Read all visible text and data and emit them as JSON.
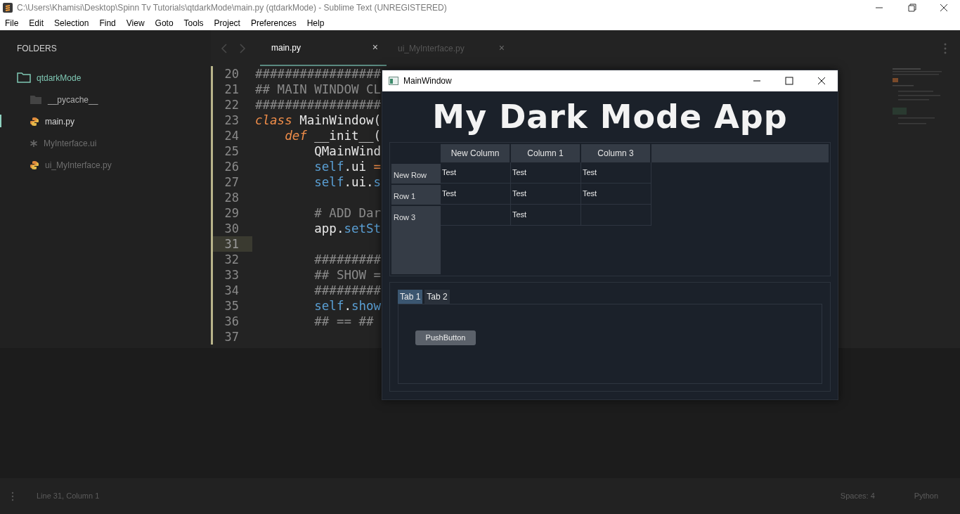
{
  "window": {
    "title": "C:\\Users\\Khamisi\\Desktop\\Spinn Tv Tutorials\\qtdarkMode\\main.py (qtdarkMode) - Sublime Text (UNREGISTERED)"
  },
  "menu": [
    "File",
    "Edit",
    "Selection",
    "Find",
    "View",
    "Goto",
    "Tools",
    "Project",
    "Preferences",
    "Help"
  ],
  "sidebar": {
    "header": "FOLDERS",
    "tree": [
      {
        "label": "qtdarkMode",
        "kind": "folder",
        "selected": false,
        "children": [
          {
            "label": "__pycache__",
            "kind": "folder",
            "selected": false
          },
          {
            "label": "main.py",
            "kind": "python",
            "selected": true
          },
          {
            "label": "MyInterface.ui",
            "kind": "ui",
            "selected": false
          },
          {
            "label": "ui_MyInterface.py",
            "kind": "python",
            "selected": false
          }
        ]
      }
    ]
  },
  "editor_tabs": [
    {
      "label": "main.py",
      "selected": true,
      "close": "×"
    },
    {
      "label": "ui_MyInterface.py",
      "selected": false,
      "close": "×"
    }
  ],
  "code": [
    {
      "number": "20",
      "current": false,
      "tokens": [
        {
          "text": "#################",
          "kind": "comment"
        }
      ]
    },
    {
      "number": "21",
      "current": false,
      "tokens": [
        {
          "text": "## MAIN WINDOW CL",
          "kind": "comment"
        }
      ]
    },
    {
      "number": "22",
      "current": false,
      "tokens": [
        {
          "text": "#################",
          "kind": "comment"
        }
      ]
    },
    {
      "number": "23",
      "current": false,
      "tokens": [
        {
          "text": "class",
          "kind": "keyword"
        },
        {
          "text": " MainWindow(",
          "kind": "plain"
        }
      ]
    },
    {
      "number": "24",
      "current": false,
      "tokens": [
        {
          "text": "    def",
          "kind": "keyword"
        },
        {
          "text": " __init__(",
          "kind": "plain"
        }
      ]
    },
    {
      "number": "25",
      "current": false,
      "tokens": [
        {
          "text": "        QMainWind",
          "kind": "plain"
        }
      ]
    },
    {
      "number": "26",
      "current": false,
      "tokens": [
        {
          "text": "        self",
          "kind": "builtin"
        },
        {
          "text": ".ui ",
          "kind": "plain"
        },
        {
          "text": "=",
          "kind": "operator"
        }
      ]
    },
    {
      "number": "27",
      "current": false,
      "tokens": [
        {
          "text": "        self",
          "kind": "builtin"
        },
        {
          "text": ".ui.",
          "kind": "plain"
        },
        {
          "text": "s",
          "kind": "builtin"
        }
      ]
    },
    {
      "number": "28",
      "current": false
    },
    {
      "number": "29",
      "current": false,
      "tokens": [
        {
          "text": "        # ADD Dar",
          "kind": "comment"
        }
      ]
    },
    {
      "number": "30",
      "current": false,
      "tokens": [
        {
          "text": "        app.",
          "kind": "plain"
        },
        {
          "text": "setSt",
          "kind": "builtin"
        }
      ]
    },
    {
      "number": "31",
      "current": true
    },
    {
      "number": "32",
      "current": false,
      "tokens": [
        {
          "text": "        #########",
          "kind": "comment"
        }
      ]
    },
    {
      "number": "33",
      "current": false,
      "tokens": [
        {
          "text": "        ## SHOW =",
          "kind": "comment"
        }
      ]
    },
    {
      "number": "34",
      "current": false,
      "tokens": [
        {
          "text": "        #########",
          "kind": "comment"
        }
      ]
    },
    {
      "number": "35",
      "current": false,
      "tokens": [
        {
          "text": "        self",
          "kind": "builtin"
        },
        {
          "text": ".",
          "kind": "plain"
        },
        {
          "text": "show",
          "kind": "builtin"
        }
      ]
    },
    {
      "number": "36",
      "current": false,
      "tokens": [
        {
          "text": "        ## == ##",
          "kind": "comment"
        }
      ]
    },
    {
      "number": "37",
      "current": false
    }
  ],
  "app": {
    "title": "MainWindow",
    "heading": "My Dark Mode App",
    "table": {
      "columns": [
        "New Column",
        "Column 1",
        "Column 3"
      ],
      "rows": [
        {
          "header": "New Row",
          "cells": [
            "Test",
            "Test",
            "Test"
          ]
        },
        {
          "header": "Row 1",
          "cells": [
            "Test",
            "Test",
            "Test"
          ]
        },
        {
          "header": "Row 3",
          "cells": [
            null,
            "Test",
            null
          ]
        }
      ]
    },
    "tabs": [
      {
        "label": "Tab 1",
        "selected": true
      },
      {
        "label": "Tab 2",
        "selected": false
      }
    ],
    "button": "PushButton"
  },
  "status_bar": {
    "position": "Line 31, Column 1",
    "indentation": "Spaces: 4",
    "syntax": "Python"
  }
}
